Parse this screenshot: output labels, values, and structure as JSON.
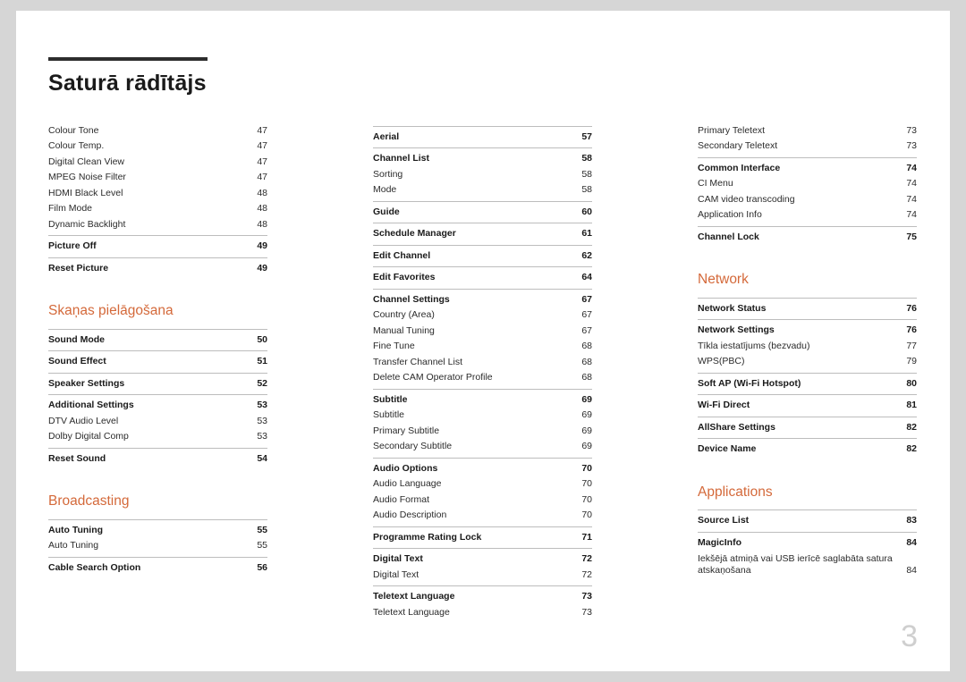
{
  "document": {
    "title": "Saturā rādītājs",
    "folio": "3"
  },
  "columns": [
    {
      "blocks": [
        {
          "type": "list",
          "entries": [
            {
              "label": "Colour Tone",
              "page": "47",
              "bold": false,
              "rule": false
            },
            {
              "label": "Colour Temp.",
              "page": "47",
              "bold": false,
              "rule": false
            },
            {
              "label": "Digital Clean View",
              "page": "47",
              "bold": false,
              "rule": false
            },
            {
              "label": "MPEG Noise Filter",
              "page": "47",
              "bold": false,
              "rule": false
            },
            {
              "label": "HDMI Black Level",
              "page": "48",
              "bold": false,
              "rule": false
            },
            {
              "label": "Film Mode",
              "page": "48",
              "bold": false,
              "rule": false
            },
            {
              "label": "Dynamic Backlight",
              "page": "48",
              "bold": false,
              "rule": false
            },
            {
              "label": "Picture Off",
              "page": "49",
              "bold": true,
              "rule": true
            },
            {
              "label": "Reset Picture",
              "page": "49",
              "bold": true,
              "rule": true
            }
          ]
        },
        {
          "type": "heading",
          "text": "Skaņas pielāgošana"
        },
        {
          "type": "list",
          "entries": [
            {
              "label": "Sound Mode",
              "page": "50",
              "bold": true,
              "rule": true
            },
            {
              "label": "Sound Effect",
              "page": "51",
              "bold": true,
              "rule": true
            },
            {
              "label": "Speaker Settings",
              "page": "52",
              "bold": true,
              "rule": true
            },
            {
              "label": "Additional Settings",
              "page": "53",
              "bold": true,
              "rule": true
            },
            {
              "label": "DTV Audio Level",
              "page": "53",
              "bold": false,
              "rule": false
            },
            {
              "label": "Dolby Digital Comp",
              "page": "53",
              "bold": false,
              "rule": false
            },
            {
              "label": "Reset Sound",
              "page": "54",
              "bold": true,
              "rule": true
            }
          ]
        },
        {
          "type": "heading",
          "text": "Broadcasting"
        },
        {
          "type": "list",
          "entries": [
            {
              "label": "Auto Tuning",
              "page": "55",
              "bold": true,
              "rule": true
            },
            {
              "label": "Auto Tuning",
              "page": "55",
              "bold": false,
              "rule": false
            },
            {
              "label": "Cable Search Option",
              "page": "56",
              "bold": true,
              "rule": true
            }
          ]
        }
      ]
    },
    {
      "blocks": [
        {
          "type": "list",
          "entries": [
            {
              "label": "Aerial",
              "page": "57",
              "bold": true,
              "rule": true
            },
            {
              "label": "Channel List",
              "page": "58",
              "bold": true,
              "rule": true
            },
            {
              "label": "Sorting",
              "page": "58",
              "bold": false,
              "rule": false
            },
            {
              "label": "Mode",
              "page": "58",
              "bold": false,
              "rule": false
            },
            {
              "label": "Guide",
              "page": "60",
              "bold": true,
              "rule": true
            },
            {
              "label": "Schedule Manager",
              "page": "61",
              "bold": true,
              "rule": true
            },
            {
              "label": "Edit Channel",
              "page": "62",
              "bold": true,
              "rule": true
            },
            {
              "label": "Edit Favorites",
              "page": "64",
              "bold": true,
              "rule": true
            },
            {
              "label": "Channel Settings",
              "page": "67",
              "bold": true,
              "rule": true
            },
            {
              "label": "Country (Area)",
              "page": "67",
              "bold": false,
              "rule": false
            },
            {
              "label": "Manual Tuning",
              "page": "67",
              "bold": false,
              "rule": false
            },
            {
              "label": "Fine Tune",
              "page": "68",
              "bold": false,
              "rule": false
            },
            {
              "label": "Transfer Channel List",
              "page": "68",
              "bold": false,
              "rule": false
            },
            {
              "label": "Delete CAM Operator Profile",
              "page": "68",
              "bold": false,
              "rule": false
            },
            {
              "label": "Subtitle",
              "page": "69",
              "bold": true,
              "rule": true
            },
            {
              "label": "Subtitle",
              "page": "69",
              "bold": false,
              "rule": false
            },
            {
              "label": "Primary Subtitle",
              "page": "69",
              "bold": false,
              "rule": false
            },
            {
              "label": "Secondary Subtitle",
              "page": "69",
              "bold": false,
              "rule": false
            },
            {
              "label": "Audio Options",
              "page": "70",
              "bold": true,
              "rule": true
            },
            {
              "label": "Audio Language",
              "page": "70",
              "bold": false,
              "rule": false
            },
            {
              "label": "Audio Format",
              "page": "70",
              "bold": false,
              "rule": false
            },
            {
              "label": "Audio Description",
              "page": "70",
              "bold": false,
              "rule": false
            },
            {
              "label": "Programme Rating Lock",
              "page": "71",
              "bold": true,
              "rule": true
            },
            {
              "label": "Digital Text",
              "page": "72",
              "bold": true,
              "rule": true
            },
            {
              "label": "Digital Text",
              "page": "72",
              "bold": false,
              "rule": false
            },
            {
              "label": "Teletext Language",
              "page": "73",
              "bold": true,
              "rule": true
            },
            {
              "label": "Teletext Language",
              "page": "73",
              "bold": false,
              "rule": false
            }
          ]
        }
      ]
    },
    {
      "blocks": [
        {
          "type": "list",
          "entries": [
            {
              "label": "Primary Teletext",
              "page": "73",
              "bold": false,
              "rule": false
            },
            {
              "label": "Secondary Teletext",
              "page": "73",
              "bold": false,
              "rule": false
            },
            {
              "label": "Common Interface",
              "page": "74",
              "bold": true,
              "rule": true
            },
            {
              "label": "CI Menu",
              "page": "74",
              "bold": false,
              "rule": false
            },
            {
              "label": "CAM video transcoding",
              "page": "74",
              "bold": false,
              "rule": false
            },
            {
              "label": "Application Info",
              "page": "74",
              "bold": false,
              "rule": false
            },
            {
              "label": "Channel Lock",
              "page": "75",
              "bold": true,
              "rule": true
            }
          ]
        },
        {
          "type": "heading",
          "text": "Network"
        },
        {
          "type": "list",
          "entries": [
            {
              "label": "Network Status",
              "page": "76",
              "bold": true,
              "rule": true
            },
            {
              "label": "Network Settings",
              "page": "76",
              "bold": true,
              "rule": true
            },
            {
              "label": "Tīkla iestatījums (bezvadu)",
              "page": "77",
              "bold": false,
              "rule": false
            },
            {
              "label": "WPS(PBC)",
              "page": "79",
              "bold": false,
              "rule": false
            },
            {
              "label": "Soft AP (Wi-Fi Hotspot)",
              "page": "80",
              "bold": true,
              "rule": true
            },
            {
              "label": "Wi-Fi Direct",
              "page": "81",
              "bold": true,
              "rule": true
            },
            {
              "label": "AllShare Settings",
              "page": "82",
              "bold": true,
              "rule": true
            },
            {
              "label": "Device Name",
              "page": "82",
              "bold": true,
              "rule": true
            }
          ]
        },
        {
          "type": "heading",
          "text": "Applications"
        },
        {
          "type": "list",
          "entries": [
            {
              "label": "Source List",
              "page": "83",
              "bold": true,
              "rule": true
            },
            {
              "label": "MagicInfo",
              "page": "84",
              "bold": true,
              "rule": true
            },
            {
              "label": "Iekšējā atmiņā vai USB ierīcē saglabāta satura atskaņošana",
              "page": "84",
              "bold": false,
              "rule": false,
              "wrap": true
            }
          ]
        }
      ]
    }
  ]
}
